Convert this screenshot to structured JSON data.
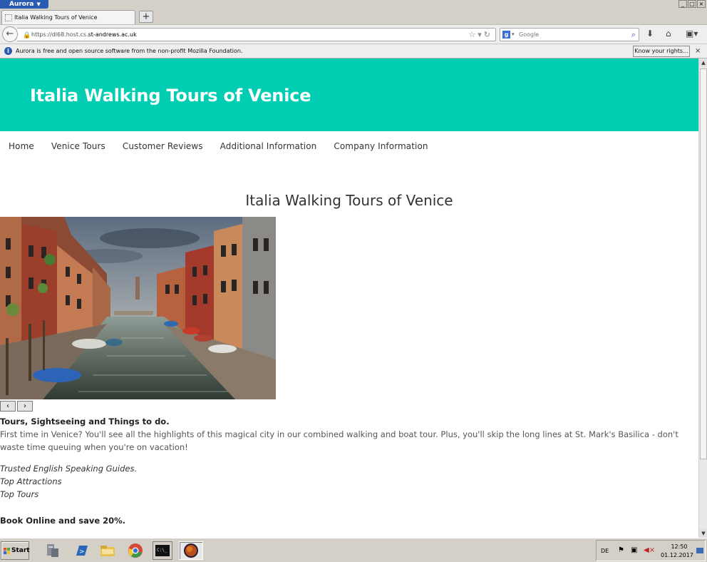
{
  "browser": {
    "app_name": "Aurora",
    "tab_title": "Italia Walking Tours of Venice",
    "url_prefix": "https://dl68.host.cs.",
    "url_host": "st-andrews.ac.uk",
    "search_placeholder": "Google",
    "notification_text": "Aurora is free and open source software from the non-profit Mozilla Foundation.",
    "notification_button": "Know your rights..."
  },
  "page": {
    "header_title": "Italia Walking Tours of Venice",
    "nav": [
      "Home",
      "Venice Tours",
      "Customer Reviews",
      "Additional Information",
      "Company Information"
    ],
    "heading": "Italia Walking Tours of Venice",
    "carousel_prev": "‹",
    "carousel_next": "›",
    "section_title": "Tours, Sightseeing and Things to do.",
    "intro": "First time in Venice? You'll see all the highlights of this magical city in our combined walking and boat tour. Plus, you'll skip the long lines at St. Mark's Basilica - don't waste time queuing when you're on vacation!",
    "features": [
      "Trusted English Speaking Guides.",
      "Top Attractions",
      "Top Tours"
    ],
    "book_text": "Book Online and save 20%."
  },
  "taskbar": {
    "start_label": "Start",
    "lang": "DE",
    "time": "12:50",
    "date": "01.12.2017"
  },
  "colors": {
    "header_bg": "#00cdb1",
    "header_text": "#ffffff"
  }
}
